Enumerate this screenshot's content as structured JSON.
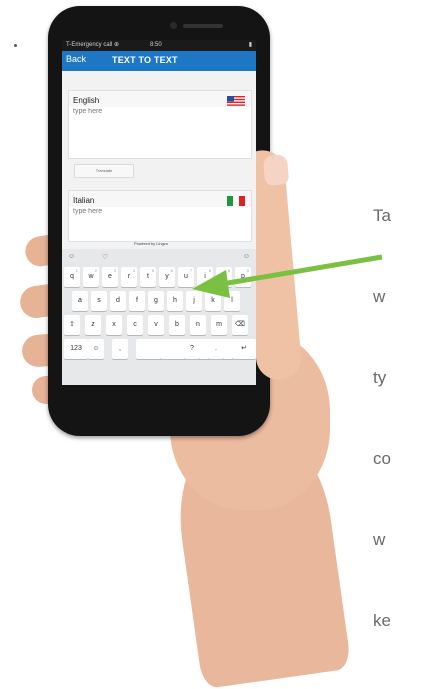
{
  "status_bar": {
    "carrier": "T-Emergency call ⊕",
    "time": "8:50",
    "battery": "▮"
  },
  "app_header": {
    "back_label": "Back",
    "title": "TEXT TO TEXT"
  },
  "english_card": {
    "language": "English",
    "placeholder": "type here",
    "flag_icon": "us-flag-icon"
  },
  "translate_button": {
    "label": "Translate"
  },
  "italian_card": {
    "language": "Italian",
    "placeholder": "type here",
    "flag_icon": "italy-flag-icon"
  },
  "powered_by": "Powered by Lingvo",
  "keyboard": {
    "top_icons": [
      "☺",
      "♡",
      "☺"
    ],
    "rows": [
      {
        "keys": [
          "q",
          "w",
          "e",
          "r",
          "t",
          "y",
          "u",
          "i",
          "o",
          "p"
        ],
        "hints": [
          "1",
          "2",
          "3",
          "4",
          "5",
          "6",
          "7",
          "8",
          "9",
          "0"
        ]
      },
      {
        "keys": [
          "a",
          "s",
          "d",
          "f",
          "g",
          "h",
          "j",
          "k",
          "l"
        ],
        "hints": [
          "",
          "",
          "",
          "",
          "",
          "",
          "",
          "",
          ""
        ]
      },
      {
        "keys": [
          "⇧",
          "z",
          "x",
          "c",
          "v",
          "b",
          "n",
          "m",
          "⌫"
        ],
        "hints": [
          "",
          "",
          "",
          "",
          "",
          "",
          "",
          "",
          ""
        ]
      },
      {
        "keys": [
          "123",
          "☺",
          ",",
          "",
          "",
          "?",
          ".",
          "↵"
        ],
        "hints": [
          "",
          "",
          "",
          "",
          "",
          "",
          "",
          ""
        ]
      }
    ]
  },
  "caption": {
    "lines": [
      "Ta",
      "w",
      "ty",
      "co",
      "w",
      "ke"
    ]
  },
  "colors": {
    "accent": "#1e77c5",
    "arrow": "#7ac143"
  }
}
